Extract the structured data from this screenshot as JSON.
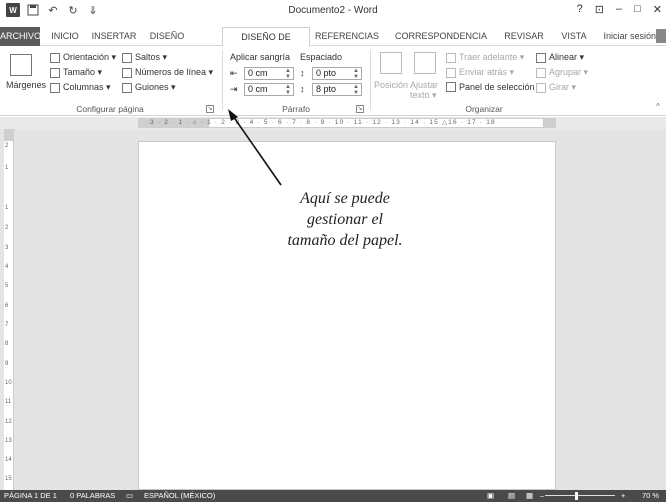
{
  "window": {
    "title": "Documento2 - Word",
    "help": "?",
    "controls": [
      "⊡",
      "–",
      "□",
      "✕"
    ]
  },
  "tabs": [
    {
      "label": "ARCHIVO",
      "active": false,
      "file": true
    },
    {
      "label": "INICIO",
      "active": false
    },
    {
      "label": "INSERTAR",
      "active": false
    },
    {
      "label": "DISEÑO",
      "active": false
    },
    {
      "label": "DISEÑO DE PÁGINA",
      "active": true
    },
    {
      "label": "REFERENCIAS",
      "active": false
    },
    {
      "label": "CORRESPONDENCIA",
      "active": false
    },
    {
      "label": "REVISAR",
      "active": false
    },
    {
      "label": "VISTA",
      "active": false
    }
  ],
  "signin": "Iniciar sesión",
  "ribbon": {
    "configurar": {
      "label": "Configurar página",
      "margenes": "Márgenes",
      "orientacion": "Orientación ▾",
      "tamano": "Tamaño ▾",
      "columnas": "Columnas ▾",
      "saltos": "Saltos ▾",
      "numeros": "Números de línea ▾",
      "guiones": "Guiones ▾"
    },
    "parrafo": {
      "label": "Párrafo",
      "sangria": "Aplicar sangría",
      "espaciado": "Espaciado",
      "izq": "0 cm",
      "der": "0 cm",
      "antes": "0 pto",
      "despues": "8 pto"
    },
    "organizar": {
      "label": "Organizar",
      "posicion": "Posición",
      "ajustar": "Ajustar texto ▾",
      "traer": "Traer adelante ▾",
      "enviar": "Enviar atrás ▾",
      "panel": "Panel de selección",
      "alinear": "Alinear ▾",
      "agrupar": "Agrupar ▾",
      "girar": "Girar ▾"
    }
  },
  "ruler": {
    "ticks": "3 · 2 · 1 · ⌂ · 1 · 2 · 3 · 4 · 5 · 6 · 7 · 8 · 9 · 10 · 11 · 12 · 13 · 14 · 15 △16 · 17 · 18",
    "vticks": [
      "2",
      "1",
      "1",
      "2",
      "3",
      "4",
      "5",
      "6",
      "7",
      "8",
      "9",
      "10",
      "11",
      "12",
      "13",
      "14",
      "15"
    ]
  },
  "annotation": {
    "line1": "Aquí se puede",
    "line2": "gestionar el",
    "line3": "tamaño  del papel."
  },
  "status": {
    "page": "PÁGINA 1 DE 1",
    "words": "0 PALABRAS",
    "lang": "ESPAÑOL (MÉXICO)",
    "zoom": "70 %"
  }
}
